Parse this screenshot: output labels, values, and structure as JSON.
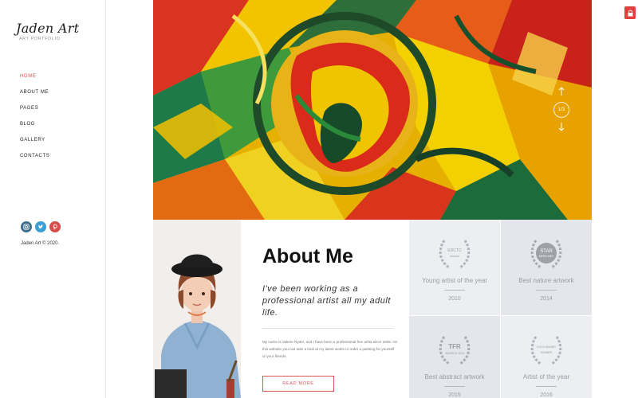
{
  "brand": {
    "name": "Jaden Art",
    "tagline": "ART PORTFOLIO"
  },
  "nav": [
    {
      "label": "HOME",
      "active": true
    },
    {
      "label": "ABOUT ME",
      "active": false
    },
    {
      "label": "PAGES",
      "active": false
    },
    {
      "label": "BLOG",
      "active": false
    },
    {
      "label": "GALLERY",
      "active": false
    },
    {
      "label": "CONTACTS",
      "active": false
    }
  ],
  "socials": [
    {
      "icon": "instagram-icon",
      "color": "#3f6f8f"
    },
    {
      "icon": "twitter-icon",
      "color": "#3b9ed6"
    },
    {
      "icon": "pinterest-icon",
      "color": "#d94a4a"
    }
  ],
  "copyright": "Jaden Art © 2020.",
  "slider": {
    "counter": "1/3"
  },
  "about": {
    "title": "About Me",
    "lead": "I've been working as a professional artist all my adult life.",
    "body": "My name is Valerie Ryder, and I have been a professional fine artist since 2005. On this website you can take a look at my latest works or order a painting for yourself or your friends.",
    "button": "READ MORE"
  },
  "awards": [
    {
      "emblem_text": "EDCTO",
      "emblem_sub": "Awards",
      "title": "Young artist of the year",
      "year": "2010"
    },
    {
      "emblem_text": "STAR",
      "emblem_sub": "MERCHANT",
      "title": "Best nature artwork",
      "year": "2014"
    },
    {
      "emblem_text": "TFR",
      "emblem_sub": "AWARDS 2015",
      "title": "Best abstract artwork",
      "year": "2015"
    },
    {
      "emblem_text": "GOLD AWARD",
      "emblem_sub": "WINNER",
      "title": "Artist of the year",
      "year": "2016"
    }
  ],
  "colors": {
    "accent": "#d9534f",
    "lock": "#e0413f",
    "award_bg": "#edeef2"
  }
}
